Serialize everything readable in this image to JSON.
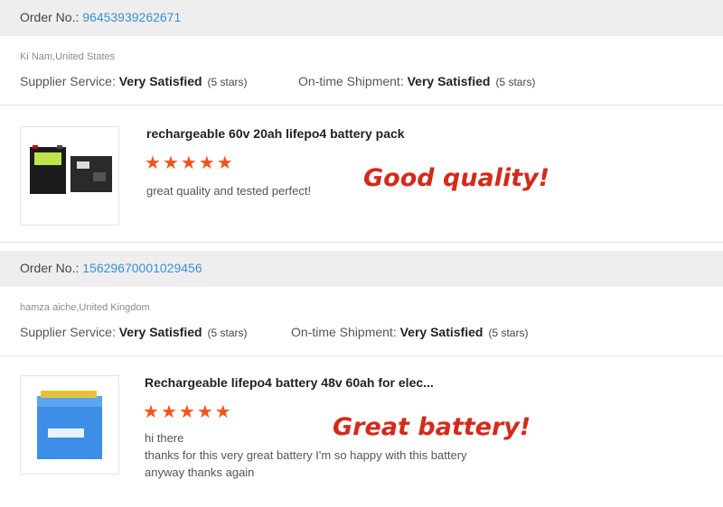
{
  "reviews": [
    {
      "order_label": "Order No.: ",
      "order_number": "96453939262671",
      "location": "Ki Nam,United States",
      "supplier_service_label": "Supplier Service:",
      "supplier_service_value": "Very Satisfied",
      "supplier_service_stars": "(5 stars)",
      "shipment_label": "On-time Shipment:",
      "shipment_value": "Very Satisfied",
      "shipment_stars": "(5 stars)",
      "product_title": "rechargeable 60v 20ah lifepo4 battery pack",
      "rating": 5,
      "comment_lines": [
        "great quality and tested perfect!"
      ],
      "callout": "Good quality!"
    },
    {
      "order_label": "Order No.: ",
      "order_number": "15629670001029456",
      "location": "hamza aiche,United Kingdom",
      "supplier_service_label": "Supplier Service:",
      "supplier_service_value": "Very Satisfied",
      "supplier_service_stars": "(5 stars)",
      "shipment_label": "On-time Shipment:",
      "shipment_value": "Very Satisfied",
      "shipment_stars": "(5 stars)",
      "product_title": "Rechargeable lifepo4 battery 48v 60ah for elec...",
      "rating": 5,
      "comment_lines": [
        "hi there",
        "thanks for this very great battery I'm so happy with this battery",
        "anyway thanks again"
      ],
      "callout": "Great battery!"
    }
  ],
  "colors": {
    "order_number": "#3a8fd6",
    "star": "#f4531b",
    "callout": "#d42a1a"
  },
  "icons": {
    "star": "star-icon"
  }
}
